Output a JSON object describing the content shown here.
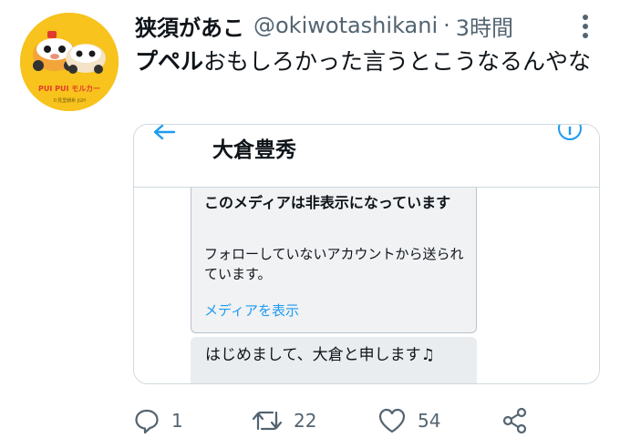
{
  "tweet": {
    "author_name": "狭須があこ",
    "handle": "@okiwotashikani",
    "separator": "·",
    "time": "3時間",
    "text_highlight": "プペル",
    "text_rest": "おもしろかった言うとこうなるんやな"
  },
  "avatar": {
    "logo_text": "PUI PUI モルカー",
    "copyright": "©見里朝希 JGH"
  },
  "quote": {
    "dm_title": "大倉豊秀",
    "media_notice": {
      "title": "このメディアは非表示になっています",
      "description": "フォローしていないアカウントから送られています。",
      "link": "メディアを表示"
    },
    "message": "はじめまして、大倉と申します♫"
  },
  "actions": {
    "reply_count": "1",
    "retweet_count": "22",
    "like_count": "54"
  },
  "colors": {
    "accent": "#1d9bf0",
    "avatar_bg": "#f7c31c",
    "secondary_text": "#536471"
  }
}
